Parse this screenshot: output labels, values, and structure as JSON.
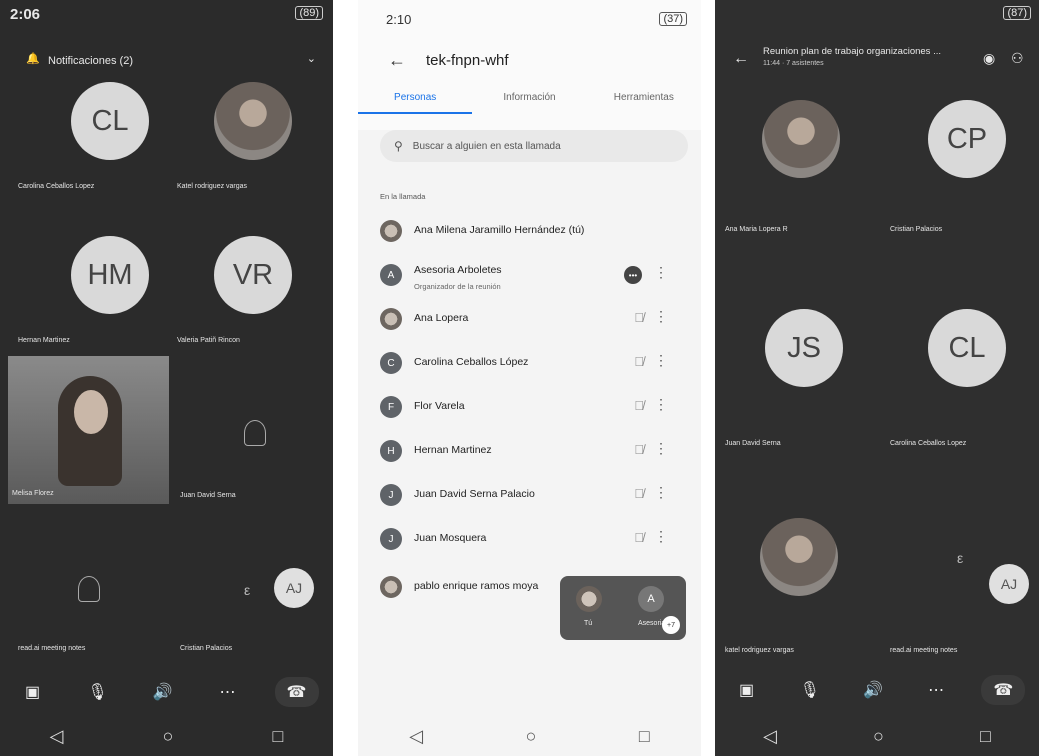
{
  "screen1": {
    "time": "2:06",
    "battery": "(89)",
    "notification": "Notificaciones (2)",
    "tiles": [
      {
        "initials": "CL",
        "label": "Carolina Ceballos Lopez"
      },
      {
        "label": "Katel rodriguez vargas"
      },
      {
        "initials": "HM",
        "label": "Hernan Martinez"
      },
      {
        "initials": "VR",
        "label": "Valeria Patiñ Rincon"
      },
      {
        "label": "Melisa Florez"
      },
      {
        "label": "Juan David Serna"
      },
      {
        "label": "read.ai meeting notes"
      },
      {
        "label": "Cristian Palacios"
      }
    ],
    "self_initials": "AJ"
  },
  "screen2": {
    "time": "2:10",
    "battery": "(37)",
    "meeting_code": "tek-fnpn-whf",
    "tabs": [
      "Personas",
      "Información",
      "Herramientas"
    ],
    "search_placeholder": "Buscar a alguien en esta llamada",
    "section_label": "En la llamada",
    "people": [
      {
        "name": "Ana Milena Jaramillo Hernández (tú)",
        "initial": "",
        "photo": true
      },
      {
        "name": "Asesoria Arboletes",
        "sub": "Organizador de la reunión",
        "initial": "A"
      },
      {
        "name": "Ana Lopera",
        "initial": "",
        "photo": true
      },
      {
        "name": "Carolina Ceballos López",
        "initial": "C"
      },
      {
        "name": "Flor Varela",
        "initial": "F"
      },
      {
        "name": "Hernan Martinez",
        "initial": "H"
      },
      {
        "name": "Juan David Serna Palacio",
        "initial": "J"
      },
      {
        "name": "Juan Mosquera",
        "initial": "J"
      },
      {
        "name": "pablo enrique ramos moya",
        "initial": "",
        "photo": true
      }
    ],
    "self_view": {
      "you_label": "Tú",
      "other_label": "Asesoria",
      "other_initial": "A",
      "extra_count": "+7"
    }
  },
  "screen3": {
    "battery": "(87)",
    "title": "Reunion plan de trabajo organizaciones ...",
    "subtitle": "11:44 · 7 asistentes",
    "tiles": [
      {
        "label": "Ana Maria Lopera R"
      },
      {
        "initials": "CP",
        "label": "Cristian Palacios"
      },
      {
        "initials": "JS",
        "label": "Juan David Serna"
      },
      {
        "initials": "CL",
        "label": "Carolina Ceballos Lopez"
      },
      {
        "label": "katel rodriguez vargas"
      },
      {
        "label": "read.ai meeting notes"
      }
    ],
    "self_initials": "AJ"
  },
  "nav_icons": [
    "back-triangle",
    "home-circle",
    "recents-square"
  ]
}
